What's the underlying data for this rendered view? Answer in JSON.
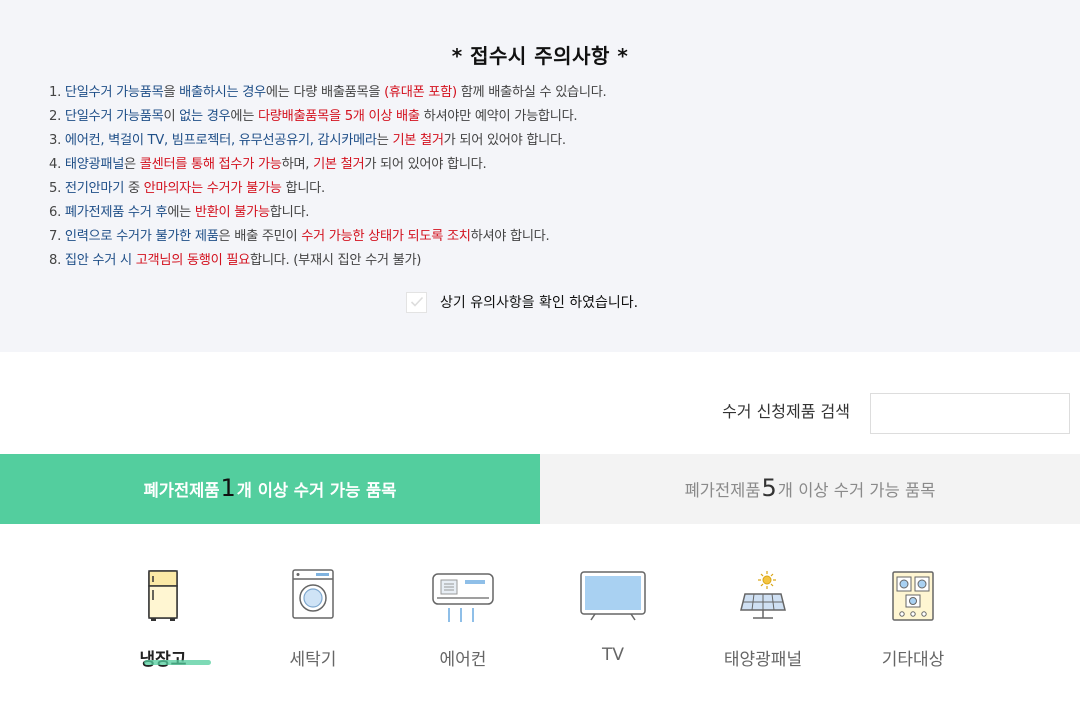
{
  "notice": {
    "title": "* 접수시 주의사항 *",
    "rules": [
      {
        "segments": [
          {
            "t": "1. "
          },
          {
            "t": "단일수거 가능품목",
            "c": "b"
          },
          {
            "t": "을 "
          },
          {
            "t": "배출하시는 경우",
            "c": "b"
          },
          {
            "t": "에는 다량 배출품목을 "
          },
          {
            "t": "(휴대폰 포함)",
            "c": "r"
          },
          {
            "t": " 함께 배출하실 수 있습니다."
          }
        ]
      },
      {
        "segments": [
          {
            "t": "2. "
          },
          {
            "t": "단일수거 가능품목",
            "c": "b"
          },
          {
            "t": "이 "
          },
          {
            "t": "없는 경우",
            "c": "b"
          },
          {
            "t": "에는 "
          },
          {
            "t": "다량배출품목을 5개 이상 배출",
            "c": "r"
          },
          {
            "t": " 하셔야만 예약이 가능합니다."
          }
        ]
      },
      {
        "segments": [
          {
            "t": "3. "
          },
          {
            "t": "에어컨, 벽걸이 TV, 빔프로젝터, 유무선공유기, 감시카메라",
            "c": "b"
          },
          {
            "t": "는 "
          },
          {
            "t": "기본 철거",
            "c": "r"
          },
          {
            "t": "가 되어 있어야 합니다."
          }
        ]
      },
      {
        "segments": [
          {
            "t": "4. "
          },
          {
            "t": "태양광패널",
            "c": "b"
          },
          {
            "t": "은 "
          },
          {
            "t": "콜센터를 통해 접수가 가능",
            "c": "r"
          },
          {
            "t": "하며, "
          },
          {
            "t": "기본 철거",
            "c": "r"
          },
          {
            "t": "가 되어 있어야 합니다."
          }
        ]
      },
      {
        "segments": [
          {
            "t": "5. "
          },
          {
            "t": "전기안마기",
            "c": "b"
          },
          {
            "t": " 중 "
          },
          {
            "t": "안마의자는 수거가 불가능",
            "c": "r"
          },
          {
            "t": " 합니다."
          }
        ]
      },
      {
        "segments": [
          {
            "t": "6. "
          },
          {
            "t": "폐가전제품 수거 후",
            "c": "b"
          },
          {
            "t": "에는 "
          },
          {
            "t": "반환이 불가능",
            "c": "r"
          },
          {
            "t": "합니다."
          }
        ]
      },
      {
        "segments": [
          {
            "t": "7. "
          },
          {
            "t": "인력으로 수거가 불가한 제품",
            "c": "b"
          },
          {
            "t": "은 배출 주민이 "
          },
          {
            "t": "수거 가능한 상태가 되도록 조치",
            "c": "r"
          },
          {
            "t": "하셔야 합니다."
          }
        ]
      },
      {
        "segments": [
          {
            "t": "8. "
          },
          {
            "t": "집안 수거 시 ",
            "c": "b"
          },
          {
            "t": "고객님의 동행이 필요",
            "c": "r"
          },
          {
            "t": "합니다. (부재시 집안 수거 불가)"
          }
        ]
      }
    ],
    "confirm_label": "상기 유의사항을 확인 하였습니다.",
    "confirm_checked": true
  },
  "search": {
    "label": "수거 신청제품 검색",
    "value": ""
  },
  "tabs": [
    {
      "prefix": "폐가전제품 ",
      "count": "1",
      "suffix": "개 이상 수거 가능 품목",
      "active": true
    },
    {
      "prefix": "폐가전제품 ",
      "count": "5",
      "suffix": "개 이상 수거 가능 품목",
      "active": false
    }
  ],
  "categories": [
    {
      "label": "냉장고",
      "icon": "refrigerator-icon",
      "active": true
    },
    {
      "label": "세탁기",
      "icon": "washing-machine-icon",
      "active": false
    },
    {
      "label": "에어컨",
      "icon": "air-conditioner-icon",
      "active": false
    },
    {
      "label": "TV",
      "icon": "tv-icon",
      "active": false
    },
    {
      "label": "태양광패널",
      "icon": "solar-panel-icon",
      "active": false
    },
    {
      "label": "기타대상",
      "icon": "other-items-icon",
      "active": false
    }
  ],
  "colors": {
    "accent": "#53ce9e",
    "rule_blue": "#1f4f88",
    "rule_red": "#d3121f"
  }
}
